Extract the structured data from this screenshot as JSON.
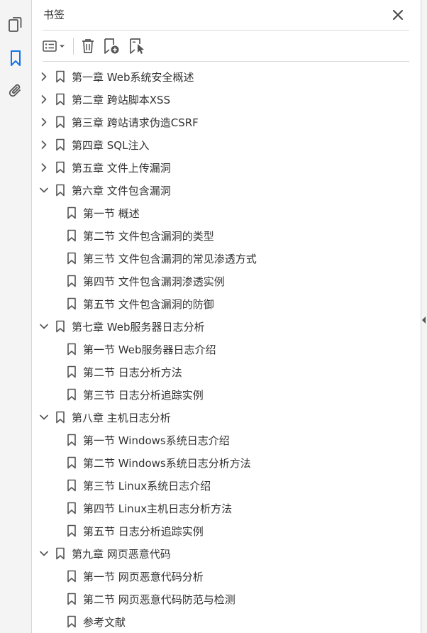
{
  "panel": {
    "title": "书签"
  },
  "rail": {
    "icons": [
      "pages-icon",
      "bookmark-icon",
      "attachment-icon"
    ]
  },
  "toolbar": {
    "buttons": [
      "options-menu-button",
      "delete-bookmark-button",
      "new-bookmark-button",
      "bookmark-from-selection-button"
    ]
  },
  "colors": {
    "accent": "#1473e6",
    "icon": "#555555",
    "text": "#333333",
    "divider": "#d9d9d9"
  },
  "bookmarks": [
    {
      "label": "第一章  Web系统安全概述",
      "level": 0,
      "expanded": false
    },
    {
      "label": "第二章  跨站脚本XSS",
      "level": 0,
      "expanded": false
    },
    {
      "label": "第三章  跨站请求伪造CSRF",
      "level": 0,
      "expanded": false
    },
    {
      "label": "第四章  SQL注入",
      "level": 0,
      "expanded": false
    },
    {
      "label": "第五章  文件上传漏洞",
      "level": 0,
      "expanded": false
    },
    {
      "label": "第六章  文件包含漏洞",
      "level": 0,
      "expanded": true
    },
    {
      "label": "第一节  概述",
      "level": 1
    },
    {
      "label": "第二节  文件包含漏洞的类型",
      "level": 1
    },
    {
      "label": "第三节  文件包含漏洞的常见渗透方式",
      "level": 1
    },
    {
      "label": "第四节  文件包含漏洞渗透实例",
      "level": 1
    },
    {
      "label": "第五节  文件包含漏洞的防御",
      "level": 1
    },
    {
      "label": "第七章  Web服务器日志分析",
      "level": 0,
      "expanded": true
    },
    {
      "label": "第一节  Web服务器日志介绍",
      "level": 1
    },
    {
      "label": "第二节  日志分析方法",
      "level": 1
    },
    {
      "label": "第三节  日志分析追踪实例",
      "level": 1
    },
    {
      "label": "第八章  主机日志分析",
      "level": 0,
      "expanded": true
    },
    {
      "label": "第一节  Windows系统日志介绍",
      "level": 1
    },
    {
      "label": "第二节  Windows系统日志分析方法",
      "level": 1
    },
    {
      "label": "第三节  Linux系统日志介绍",
      "level": 1
    },
    {
      "label": "第四节  Linux主机日志分析方法",
      "level": 1
    },
    {
      "label": "第五节  日志分析追踪实例",
      "level": 1
    },
    {
      "label": "第九章  网页恶意代码",
      "level": 0,
      "expanded": true
    },
    {
      "label": "第一节  网页恶意代码分析",
      "level": 1
    },
    {
      "label": "第二节  网页恶意代码防范与检测",
      "level": 1
    },
    {
      "label": "参考文献",
      "level": 1
    }
  ]
}
